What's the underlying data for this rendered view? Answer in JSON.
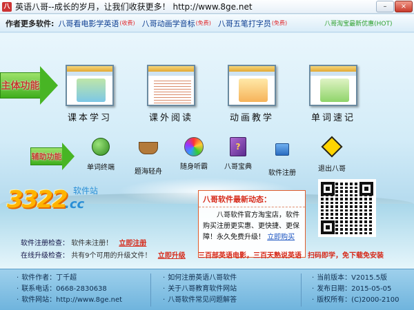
{
  "window": {
    "title": "英语八哥--成长的岁月，让我们收获更多！ http://www.8ge.net",
    "app_icon": "八",
    "minimize": "–",
    "close": "×"
  },
  "topbar": {
    "label": "作者更多软件:",
    "links": [
      {
        "text": "八哥看电影学英语",
        "tag": "(收费)"
      },
      {
        "text": "八哥动画学音标",
        "tag": "(免费)"
      },
      {
        "text": "八哥五笔打字员",
        "tag": "(免费)"
      }
    ],
    "hot": "八哥淘宝最新优惠(HOT)"
  },
  "sections": {
    "main_label": "主体功能",
    "aux_label": "辅助功能"
  },
  "main_features": [
    {
      "label": "课本学习",
      "icon": "textbook-thumbnail"
    },
    {
      "label": "课外阅读",
      "icon": "reading-thumbnail"
    },
    {
      "label": "动画教学",
      "icon": "animation-thumbnail"
    },
    {
      "label": "单词速记",
      "icon": "vocab-thumbnail"
    }
  ],
  "tools": [
    {
      "label": "单词终端",
      "icon": "green-bug-icon"
    },
    {
      "label": "题海轻舟",
      "icon": "boat-icon"
    },
    {
      "label": "随身听霸",
      "icon": "cd-icon"
    },
    {
      "label": "八哥宝典",
      "icon": "book-icon",
      "glyph": "?"
    },
    {
      "label": "软件注册",
      "icon": "lock-icon"
    },
    {
      "label": "退出八哥",
      "icon": "exit-sign-icon"
    }
  ],
  "logo": {
    "number": "3322",
    "suffix": ".cc",
    "sub": "软件站"
  },
  "news": {
    "title": "八哥软件最新动态：",
    "body": "八哥软件官方淘宝店，软件购买注册更实惠、更快捷、更保障！永久免费升级！",
    "link": "立即购买"
  },
  "status": {
    "reg_key": "软件注册检查：",
    "reg_val": "软件未注册！",
    "reg_action": "立即注册",
    "upd_key": "在线升级检查：",
    "upd_val": "共有9个可用的升级文件！",
    "upd_action": "立即升级"
  },
  "promos": {
    "p1": "三百部英语电影，三百天熟说英语",
    "p2": "扫码即学，免下载免安装"
  },
  "footer": {
    "col1": [
      "软件作者：丁千超",
      "联系电话：0668-2830638",
      "软件网站：http://www.8ge.net"
    ],
    "col2": [
      "如何注册英语八哥软件",
      "关于八哥教育软件网站",
      "八哥软件常见问题解答"
    ],
    "col3": [
      "当前版本：V2015.5版",
      "发布日期：2015-05-05",
      "版权所有：(C)2000-2100"
    ]
  },
  "colors": {
    "accent_green": "#3fae1d",
    "alert_red": "#d62a1a",
    "link_blue": "#0b3d91"
  }
}
